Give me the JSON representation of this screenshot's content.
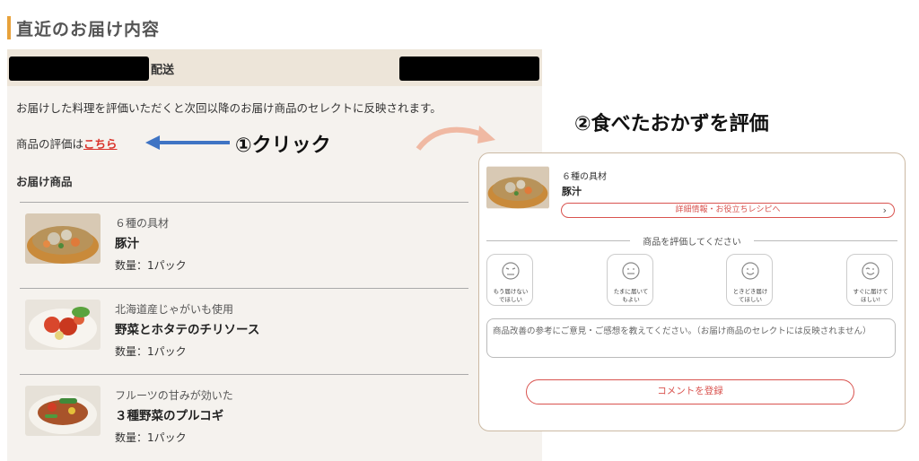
{
  "page_title": "直近のお届け内容",
  "delivery": {
    "label": "配送"
  },
  "info_text": "お届けした料理を評価いただくと次回以降のお届け商品のセレクトに反映されます。",
  "rating_prefix": "商品の評価は",
  "rating_link": "こちら",
  "products_title": "お届け商品",
  "items": [
    {
      "sub": "６種の具材",
      "name": "豚汁",
      "qty": "数量：1パック"
    },
    {
      "sub": "北海道産じゃがいも使用",
      "name": "野菜とホタテのチリソース",
      "qty": "数量：1パック"
    },
    {
      "sub": "フルーツの甘みが効いた",
      "name": "３種野菜のプルコギ",
      "qty": "数量：1パック"
    }
  ],
  "annotations": {
    "click": "①クリック",
    "rate": "②食べたおかずを評価"
  },
  "review": {
    "sub": "６種の具材",
    "name": "豚汁",
    "detail_button": "詳細情報・お役立ちレシピへ",
    "detail_chevron": "›",
    "section_title": "商品を評価してください",
    "options": [
      {
        "l1": "もう届けない",
        "l2": "でほしい",
        "icon": "frown-face-icon"
      },
      {
        "l1": "たまに届いて",
        "l2": "もよい",
        "icon": "neutral-face-icon"
      },
      {
        "l1": "ときどき届け",
        "l2": "てほしい",
        "icon": "smile-face-icon"
      },
      {
        "l1": "すぐに届けて",
        "l2": "ほしい!",
        "icon": "wink-face-icon"
      }
    ],
    "comment_placeholder": "商品改善の参考にご意見・ご感想を教えてください。（お届け商品のセレクトには反映されません）",
    "submit_button": "コメントを登録"
  },
  "colors": {
    "accent": "#e8a23b",
    "link": "#d9322a",
    "button": "#d9534f",
    "arrow": "#3f74c4",
    "curve_arrow": "#f0b9a3"
  }
}
